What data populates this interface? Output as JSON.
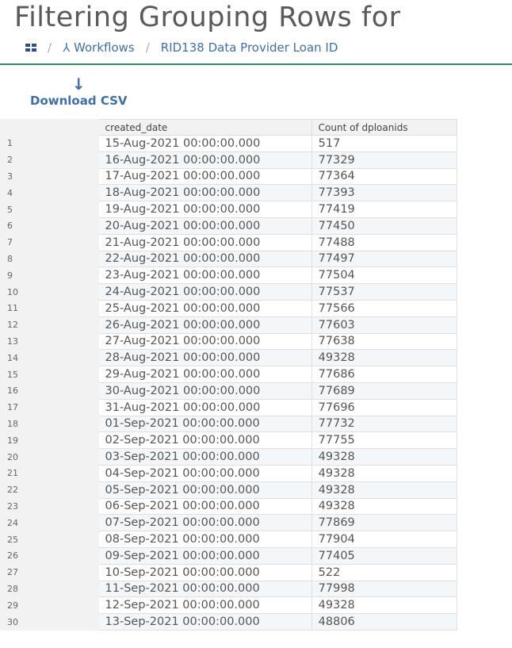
{
  "header": {
    "title": "Filtering Grouping Rows for",
    "breadcrumb": {
      "workflows": "Workflows",
      "current": "RID138 Data Provider Loan ID"
    }
  },
  "toolbar": {
    "download_label": "Download CSV"
  },
  "table": {
    "columns": [
      "",
      "created_date",
      "Count of dploanids"
    ],
    "rows": [
      [
        "1",
        "15-Aug-2021 00:00:00.000",
        "517"
      ],
      [
        "2",
        "16-Aug-2021 00:00:00.000",
        "77329"
      ],
      [
        "3",
        "17-Aug-2021 00:00:00.000",
        "77364"
      ],
      [
        "4",
        "18-Aug-2021 00:00:00.000",
        "77393"
      ],
      [
        "5",
        "19-Aug-2021 00:00:00.000",
        "77419"
      ],
      [
        "6",
        "20-Aug-2021 00:00:00.000",
        "77450"
      ],
      [
        "7",
        "21-Aug-2021 00:00:00.000",
        "77488"
      ],
      [
        "8",
        "22-Aug-2021 00:00:00.000",
        "77497"
      ],
      [
        "9",
        "23-Aug-2021 00:00:00.000",
        "77504"
      ],
      [
        "10",
        "24-Aug-2021 00:00:00.000",
        "77537"
      ],
      [
        "11",
        "25-Aug-2021 00:00:00.000",
        "77566"
      ],
      [
        "12",
        "26-Aug-2021 00:00:00.000",
        "77603"
      ],
      [
        "13",
        "27-Aug-2021 00:00:00.000",
        "77638"
      ],
      [
        "14",
        "28-Aug-2021 00:00:00.000",
        "49328"
      ],
      [
        "15",
        "29-Aug-2021 00:00:00.000",
        "77686"
      ],
      [
        "16",
        "30-Aug-2021 00:00:00.000",
        "77689"
      ],
      [
        "17",
        "31-Aug-2021 00:00:00.000",
        "77696"
      ],
      [
        "18",
        "01-Sep-2021 00:00:00.000",
        "77732"
      ],
      [
        "19",
        "02-Sep-2021 00:00:00.000",
        "77755"
      ],
      [
        "20",
        "03-Sep-2021 00:00:00.000",
        "49328"
      ],
      [
        "21",
        "04-Sep-2021 00:00:00.000",
        "49328"
      ],
      [
        "22",
        "05-Sep-2021 00:00:00.000",
        "49328"
      ],
      [
        "23",
        "06-Sep-2021 00:00:00.000",
        "49328"
      ],
      [
        "24",
        "07-Sep-2021 00:00:00.000",
        "77869"
      ],
      [
        "25",
        "08-Sep-2021 00:00:00.000",
        "77904"
      ],
      [
        "26",
        "09-Sep-2021 00:00:00.000",
        "77405"
      ],
      [
        "27",
        "10-Sep-2021 00:00:00.000",
        "522"
      ],
      [
        "28",
        "11-Sep-2021 00:00:00.000",
        "77998"
      ],
      [
        "29",
        "12-Sep-2021 00:00:00.000",
        "49328"
      ],
      [
        "30",
        "13-Sep-2021 00:00:00.000",
        "48806"
      ]
    ]
  }
}
